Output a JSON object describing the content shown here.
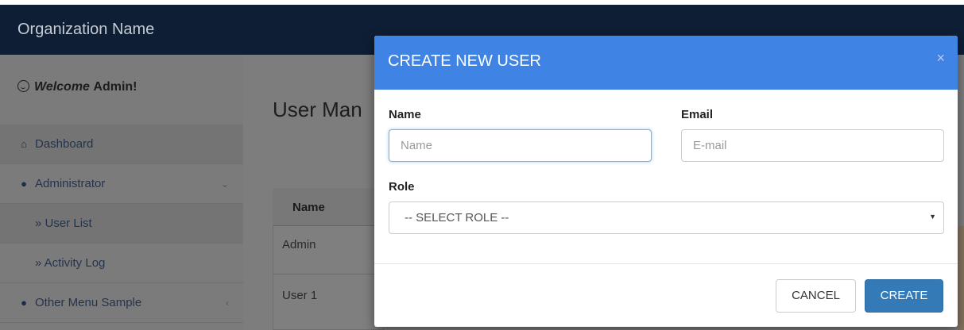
{
  "navbar": {
    "brand": "Organization Name"
  },
  "sidebar": {
    "welcome_prefix": "Welcome",
    "welcome_name": "Admin!",
    "items": [
      {
        "label": "Dashboard",
        "icon": "home-icon"
      },
      {
        "label": "Administrator",
        "icon": "user-icon"
      },
      {
        "label": "» User List"
      },
      {
        "label": "» Activity Log"
      },
      {
        "label": "Other Menu Sample",
        "icon": "user-icon"
      }
    ]
  },
  "main": {
    "page_title": "User Man",
    "table": {
      "header_name": "Name",
      "rows": [
        {
          "name": "Admin"
        },
        {
          "name": "User 1"
        }
      ]
    }
  },
  "modal": {
    "title": "CREATE NEW USER",
    "close_glyph": "×",
    "name_label": "Name",
    "name_placeholder": "Name",
    "email_label": "Email",
    "email_placeholder": "E-mail",
    "role_label": "Role",
    "role_selected": "-- SELECT ROLE --",
    "cancel_label": "CANCEL",
    "create_label": "CREATE",
    "header_color": "#3f84e5",
    "primary_button_color": "#337ab7"
  }
}
